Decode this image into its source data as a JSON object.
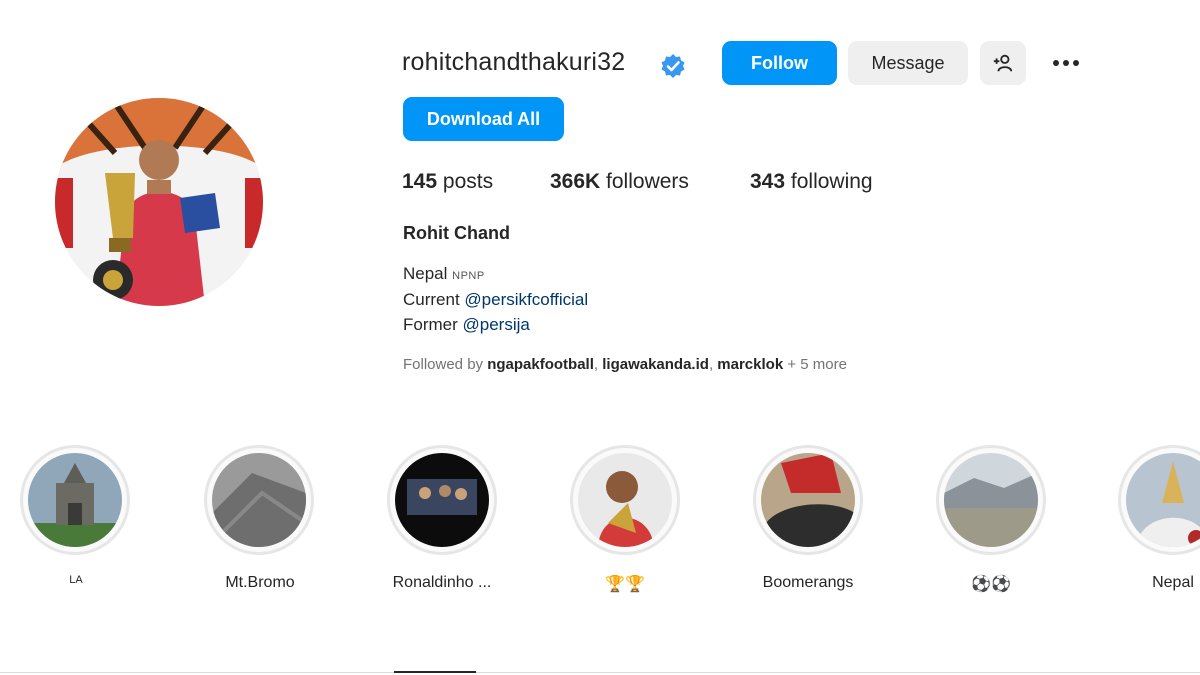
{
  "profile": {
    "username": "rohitchandthakuri32",
    "full_name": "Rohit Chand",
    "verified_icon": "verified-badge-icon",
    "accent_color": "#0095f6"
  },
  "actions": {
    "follow": "Follow",
    "message": "Message",
    "download_all": "Download All"
  },
  "stats": {
    "posts_count": "145",
    "posts_label": "posts",
    "followers_count": "366K",
    "followers_label": "followers",
    "following_count": "343",
    "following_label": "following"
  },
  "bio": {
    "line1_text": "Nepal ",
    "line1_small": "NPNP",
    "line2_text": "Current ",
    "line2_link": "@persikfcofficial",
    "line3_text": "Former ",
    "line3_link": "@persija"
  },
  "followed_by": {
    "prefix": "Followed by ",
    "accounts": [
      "ngapakfootball",
      "ligawakanda.id",
      "marcklok"
    ],
    "sep": ", ",
    "suffix": " + 5 more"
  },
  "highlights": [
    {
      "label": "LA"
    },
    {
      "label": "Mt.Bromo"
    },
    {
      "label": "Ronaldinho ..."
    },
    {
      "label": "🏆🏆"
    },
    {
      "label": "Boomerangs"
    },
    {
      "label": "⚽⚽"
    },
    {
      "label": "Nepal"
    }
  ]
}
